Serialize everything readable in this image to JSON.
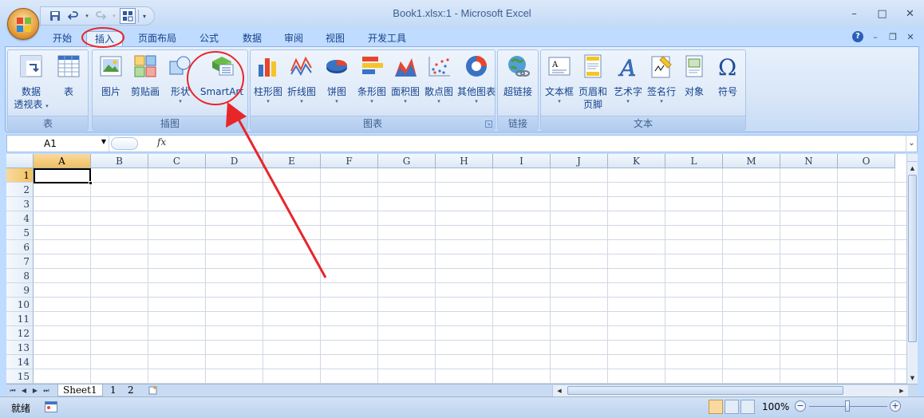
{
  "window": {
    "title": "Book1.xlsx:1 - Microsoft Excel",
    "minimize_glyph": "–",
    "maximize_glyph": "□",
    "close_glyph": "✕"
  },
  "qat": {
    "save_icon": "save-icon",
    "undo_icon": "undo-icon",
    "redo_icon": "redo-icon",
    "customize_icon": "customize-icon"
  },
  "tabs": [
    {
      "label": "开始"
    },
    {
      "label": "插入",
      "active": true
    },
    {
      "label": "页面布局"
    },
    {
      "label": "公式"
    },
    {
      "label": "数据"
    },
    {
      "label": "审阅"
    },
    {
      "label": "视图"
    },
    {
      "label": "开发工具"
    }
  ],
  "ribbon": {
    "groups": {
      "table": {
        "label": "表",
        "pivot": {
          "line1": "数据",
          "line2": "透视表"
        },
        "table": "表"
      },
      "illustrations": {
        "label": "插图",
        "picture": "图片",
        "clipart": "剪贴画",
        "shapes": "形状",
        "smartart": "SmartArt"
      },
      "charts": {
        "label": "图表",
        "items": [
          "柱形图",
          "折线图",
          "饼图",
          "条形图",
          "面积图",
          "散点图",
          "其他图表"
        ]
      },
      "links": {
        "label": "链接",
        "hyperlink": "超链接"
      },
      "text": {
        "label": "文本",
        "textbox": "文本框",
        "header": {
          "line1": "页眉和",
          "line2": "页脚"
        },
        "wordart": "艺术字",
        "signature": "签名行",
        "object": "对象",
        "symbol": "符号"
      }
    }
  },
  "formula_bar": {
    "name_box": "A1",
    "fx": "fx",
    "value": ""
  },
  "grid": {
    "columns": [
      "A",
      "B",
      "C",
      "D",
      "E",
      "F",
      "G",
      "H",
      "I",
      "J",
      "K",
      "L",
      "M",
      "N",
      "O"
    ],
    "rows": [
      "1",
      "2",
      "3",
      "4",
      "5",
      "6",
      "7",
      "8",
      "9",
      "10",
      "11",
      "12",
      "13",
      "14",
      "15"
    ],
    "active_cell": "A1"
  },
  "sheets": {
    "tabs": [
      "Sheet1",
      "1",
      "2"
    ]
  },
  "status": {
    "ready": "就绪",
    "zoom": "100%",
    "zoom_minus": "−",
    "zoom_plus": "+"
  },
  "colors": {
    "annotation": "#e8262a",
    "active_tab_bg": "#e6f0fb",
    "selected_header": "#f1c15f"
  }
}
